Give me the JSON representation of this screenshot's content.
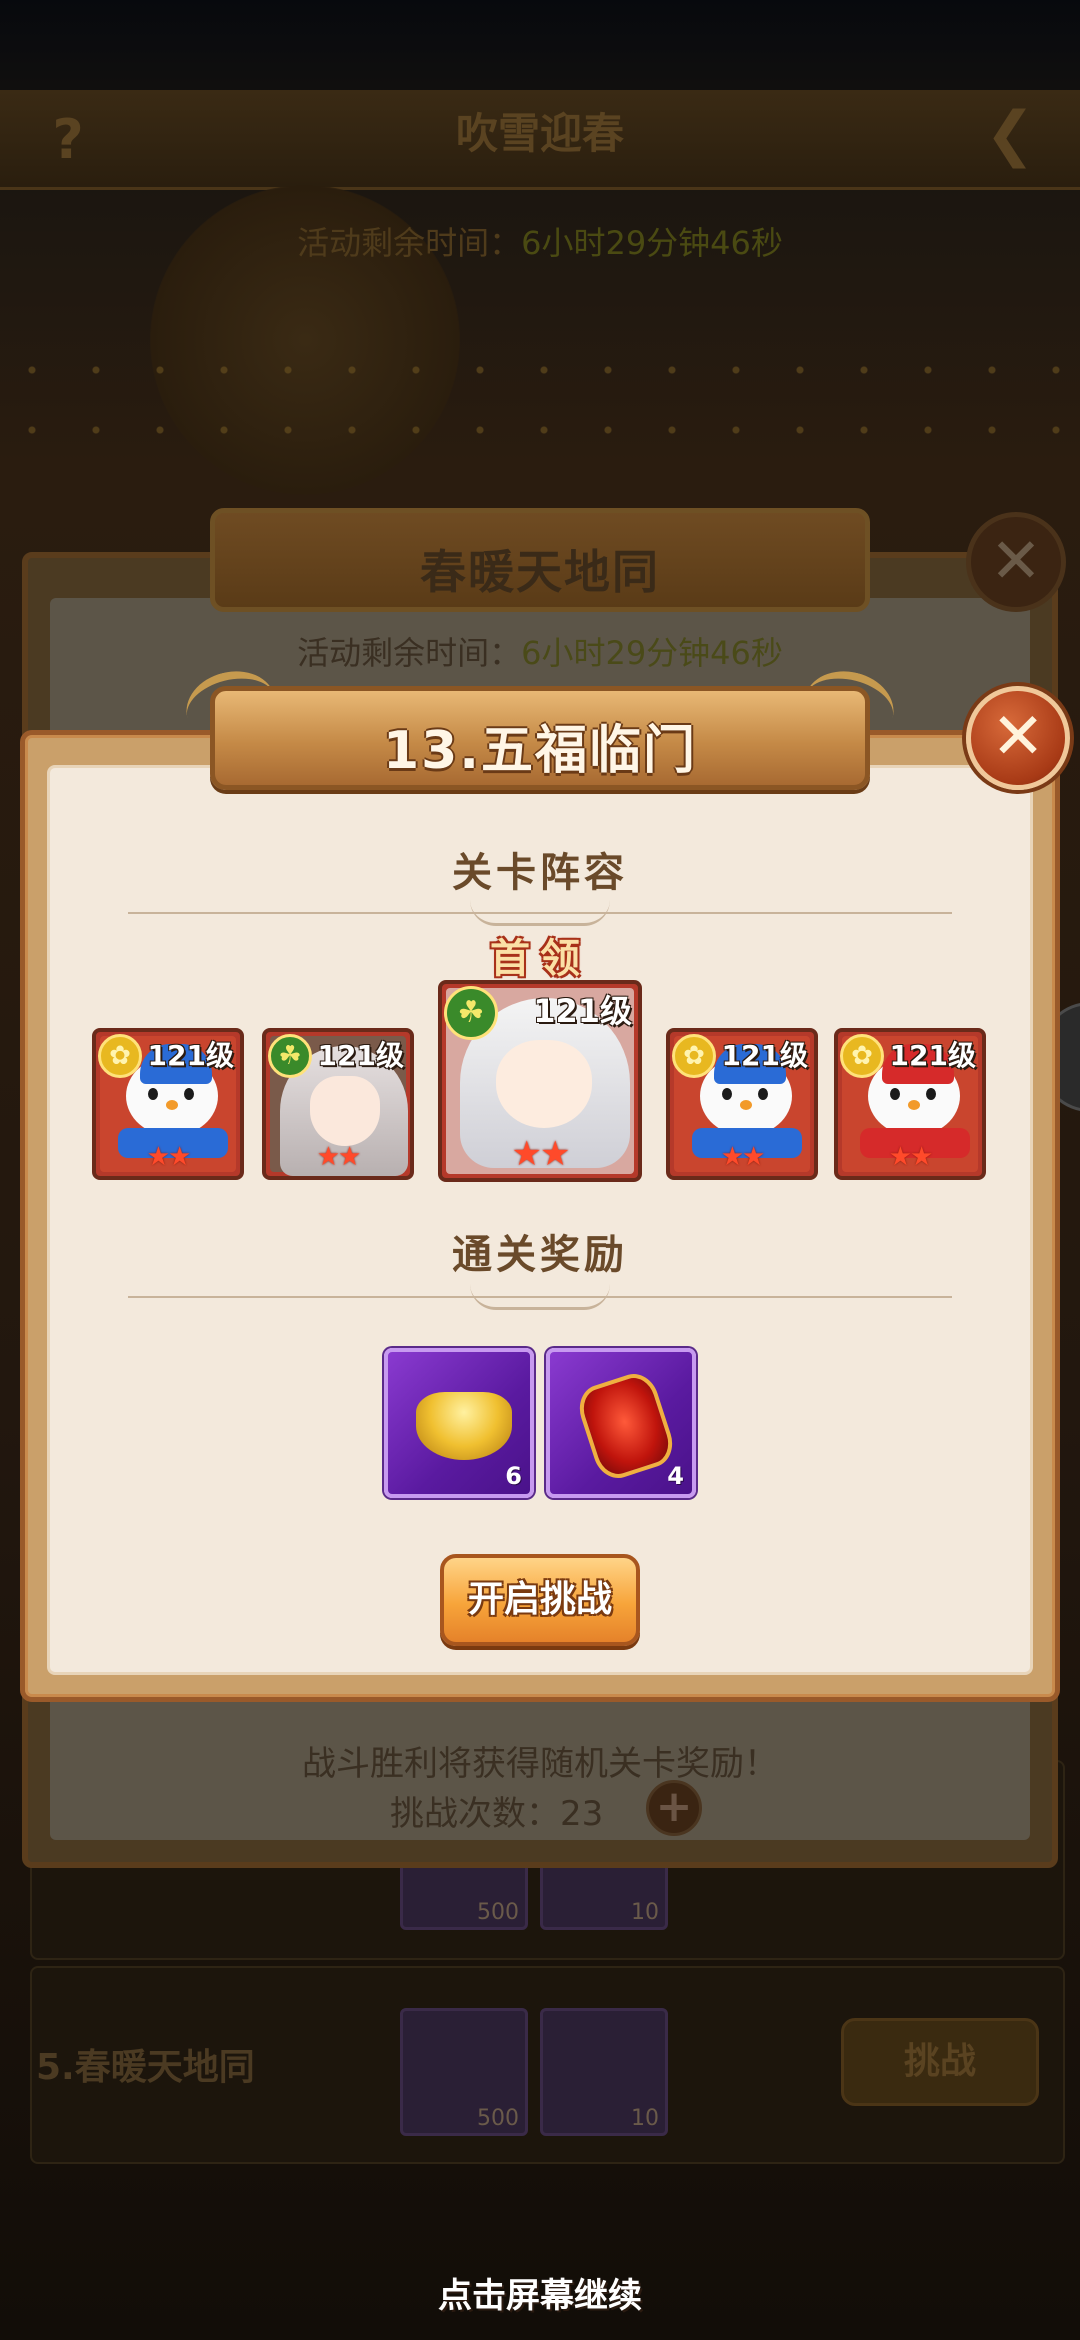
{
  "background": {
    "title": "吹雪迎春",
    "timer_label": "活动剩余时间：",
    "timer_value": "6小时29分钟46秒",
    "rows": [
      {
        "counts": [
          "500",
          "10"
        ]
      },
      {
        "label": "5.春暖天地同",
        "counts": [
          "500",
          "10"
        ],
        "button": "挑战"
      }
    ]
  },
  "back_panel": {
    "title": "春暖天地同",
    "timer_label": "活动剩余时间：",
    "timer_value": "6小时29分钟46秒",
    "footer_text": "战斗胜利将获得随机关卡奖励！",
    "attempts_label": "挑战次数：",
    "attempts_value": "23"
  },
  "dialog": {
    "title": "13.五福临门",
    "lineup_heading": "关卡阵容",
    "boss_tag": "首领",
    "heroes": [
      {
        "level": "121级",
        "stars": "★★",
        "kind": "snowman",
        "badge": "gold",
        "scarf_color": "#2a6bd6",
        "hat_color": "#2a6bd6"
      },
      {
        "level": "121级",
        "stars": "★★",
        "kind": "girl",
        "badge": "green"
      },
      {
        "level": "121级",
        "stars": "★★",
        "kind": "boss",
        "badge": "green"
      },
      {
        "level": "121级",
        "stars": "★★",
        "kind": "snowman",
        "badge": "gold",
        "scarf_color": "#2a6bd6",
        "hat_color": "#2a6bd6"
      },
      {
        "level": "121级",
        "stars": "★★",
        "kind": "snowman",
        "badge": "gold",
        "scarf_color": "#d62a2a",
        "hat_color": "#d62a2a"
      }
    ],
    "rewards_heading": "通关奖励",
    "rewards": [
      {
        "item": "gold-ingot",
        "count": "6"
      },
      {
        "item": "red-lantern",
        "count": "4"
      }
    ],
    "start_button": "开启挑战"
  },
  "continue_hint": "点击屏幕继续",
  "colors": {
    "dialog_bg": "#f3e9dc",
    "banner": "#c58a47",
    "close_red": "#a83a16",
    "button_orange": "#f7a43a",
    "reward_purple": "#5a1aa0"
  }
}
